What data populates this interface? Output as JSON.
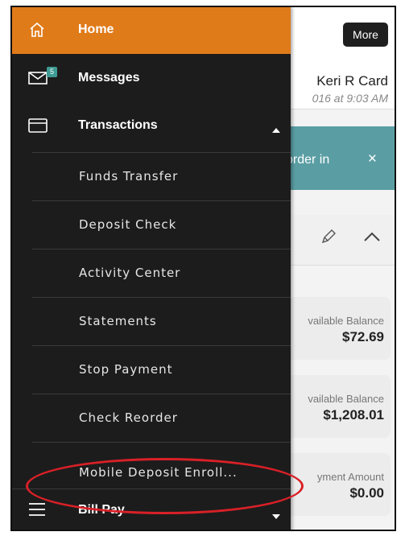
{
  "header": {
    "more_label": "More"
  },
  "user": {
    "name": "Keri R Card",
    "timestamp": "016 at 9:03 AM"
  },
  "alert": {
    "text": "order in",
    "close_glyph": "×"
  },
  "accounts": [
    {
      "label": "vailable Balance",
      "value": "$72.69"
    },
    {
      "label": "vailable Balance",
      "value": "$1,208.01"
    },
    {
      "label": "yment Amount",
      "value": "$0.00"
    }
  ],
  "nav": {
    "home": {
      "label": "Home",
      "icon": "home-icon"
    },
    "messages": {
      "label": "Messages",
      "icon": "envelope-icon",
      "badge": "5"
    },
    "transactions": {
      "label": "Transactions",
      "icon": "card-icon",
      "expanded": true
    },
    "sub_items": [
      {
        "label": "Funds Transfer"
      },
      {
        "label": "Deposit Check"
      },
      {
        "label": "Activity Center"
      },
      {
        "label": "Statements"
      },
      {
        "label": "Stop Payment"
      },
      {
        "label": "Check Reorder"
      },
      {
        "label": "Mobile Deposit Enroll..."
      }
    ],
    "bill_pay": {
      "label": "Bill Pay",
      "icon": "hamburger-icon"
    }
  },
  "colors": {
    "accent": "#e07b1a",
    "drawer": "#1c1c1c",
    "alert": "#5a9ea4",
    "badge": "#3d9c94",
    "annotation": "#d92027"
  }
}
